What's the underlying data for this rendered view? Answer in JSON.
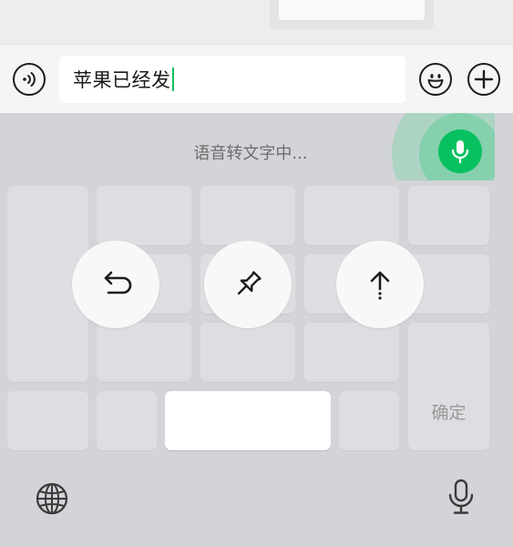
{
  "input": {
    "text": "苹果已经发"
  },
  "keyboard": {
    "status_text": "语音转文字中...",
    "confirm_label": "确定"
  },
  "colors": {
    "accent": "#07c160",
    "background": "#d2d4d8",
    "input_bar": "#f5f5f5"
  },
  "icons": {
    "voice_toggle": "voice-wave-icon",
    "emoji": "smiley-face-icon",
    "more": "plus-icon",
    "mic_active": "microphone-icon",
    "undo": "undo-arrow-icon",
    "pin": "pin-icon",
    "send": "send-up-arrow-icon",
    "language": "globe-icon",
    "voice_input": "microphone-icon"
  }
}
